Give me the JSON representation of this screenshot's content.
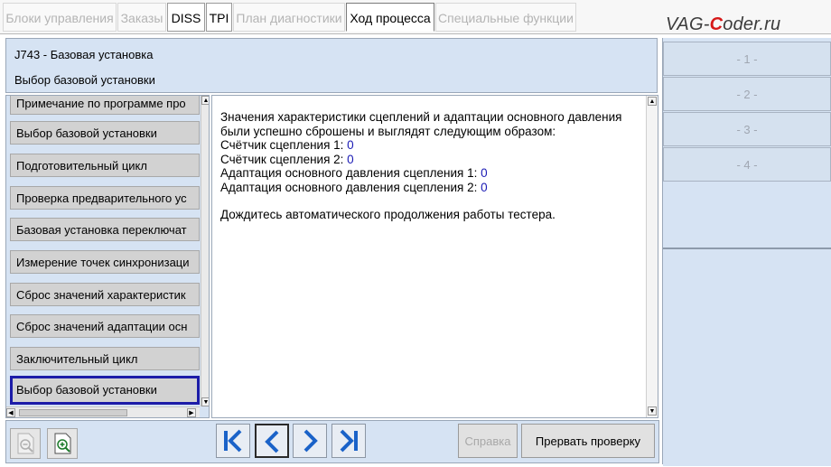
{
  "tabs": [
    {
      "label": "Блоки управления",
      "state": "disabled"
    },
    {
      "label": "Заказы",
      "state": "disabled"
    },
    {
      "label": "DISS",
      "state": "enabled"
    },
    {
      "label": "TPI",
      "state": "enabled"
    },
    {
      "label": "План диагностики",
      "state": "disabled"
    },
    {
      "label": "Ход процесса",
      "state": "active"
    },
    {
      "label": "Специальные функции",
      "state": "disabled"
    }
  ],
  "watermark": {
    "prefix": "VAG-",
    "accent": "C",
    "suffix": "oder.ru"
  },
  "header": {
    "line1": "J743 - Базовая установка",
    "line2": "Выбор базовой установки"
  },
  "side_buttons": [
    "- 1 -",
    "- 2 -",
    "- 3 -",
    "- 4 -"
  ],
  "procedure_list": {
    "items": [
      "Примечание по программе про",
      "Выбор базовой установки",
      "Подготовительный цикл",
      "Проверка предварительного ус",
      "Базовая установка переключат",
      "Измерение точек синхронизаци",
      "Сброс значений характеристик",
      "Сброс значений адаптации осн",
      "Заключительный цикл",
      "Выбор базовой установки"
    ],
    "selected_index": 9
  },
  "message": {
    "intro_line1": "Значения характеристики сцеплений и адаптации основного давления",
    "intro_line2": "были успешно сброшены и выглядят следующим образом:",
    "rows": [
      {
        "label": "Счётчик сцепления 1: ",
        "value": "0"
      },
      {
        "label": "Счётчик сцепления 2: ",
        "value": "0"
      },
      {
        "label": "Адаптация основного давления сцепления 1: ",
        "value": "0"
      },
      {
        "label": "Адаптация основного давления сцепления 2: ",
        "value": "0"
      }
    ],
    "footer": "Дождитесь автоматического продолжения работы тестера."
  },
  "buttons": {
    "help": "Справка",
    "abort": "Прервать проверку"
  },
  "colors": {
    "panel_bg": "#d6e3f3",
    "value_text": "#1a1ab4",
    "selection_border": "#1c1ca8",
    "logo_accent": "#d61818"
  }
}
